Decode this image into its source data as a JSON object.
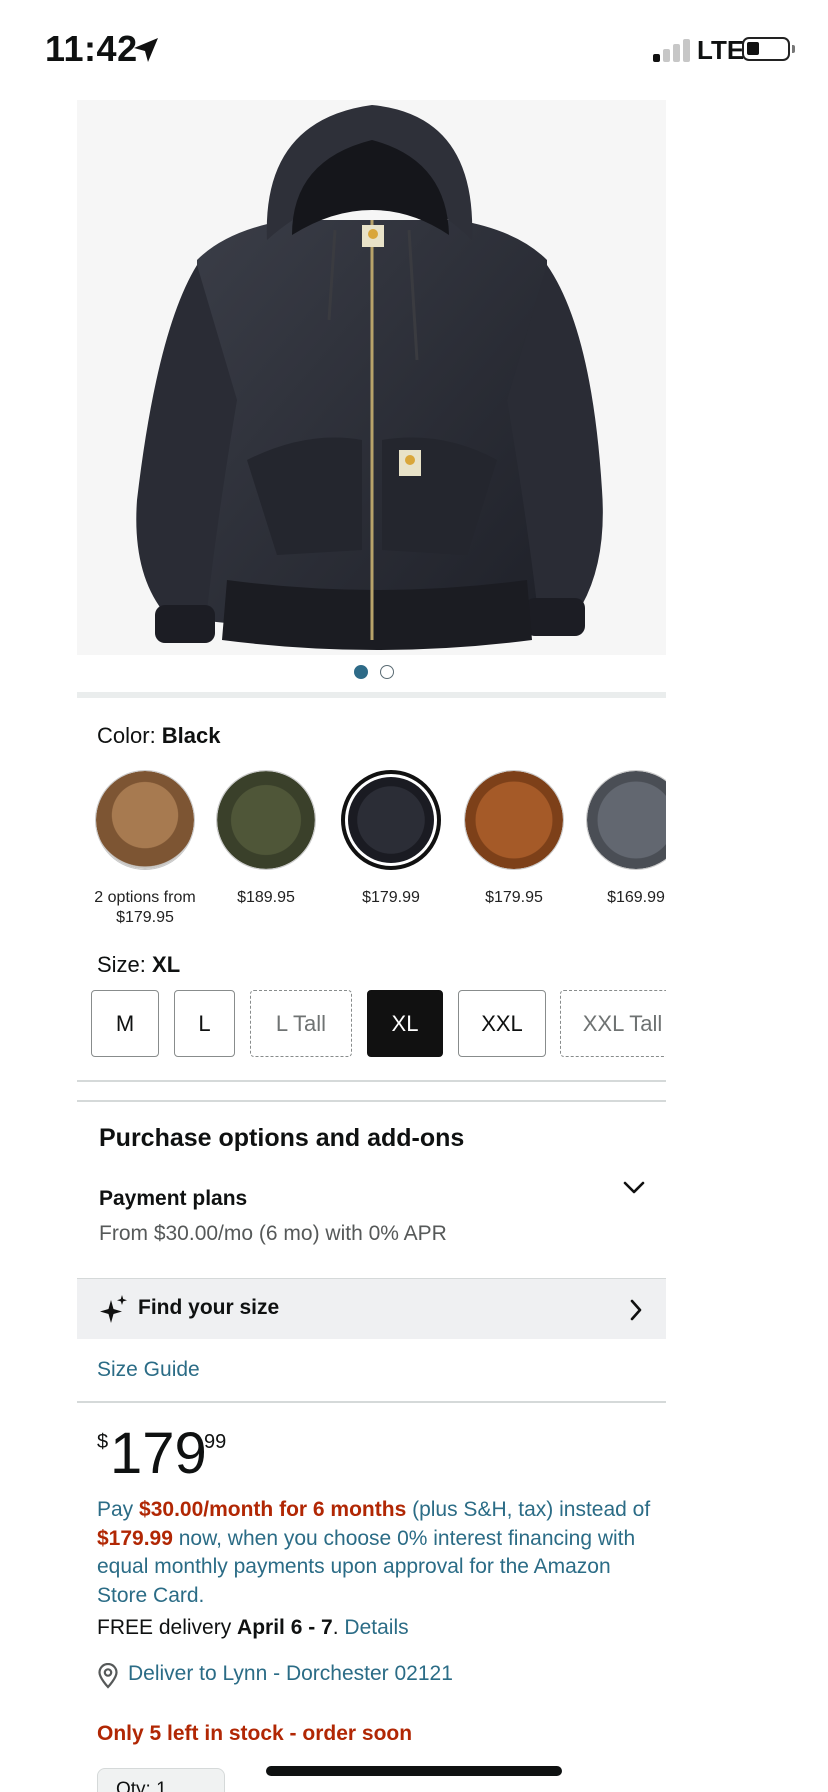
{
  "status_bar": {
    "time": "11:42",
    "network": "LTE"
  },
  "product": {
    "image_alt": "Black hooded jacket",
    "carousel": {
      "count": 2,
      "active_index": 0
    }
  },
  "color": {
    "label": "Color: ",
    "selected": "Black",
    "options": [
      {
        "line1": "2 options from",
        "line2": "$179.95",
        "color": "#9a6b44"
      },
      {
        "line1": "$189.95",
        "line2": "",
        "color": "#4c5236"
      },
      {
        "line1": "$179.99",
        "line2": "",
        "color": "#24262d",
        "selected": true
      },
      {
        "line1": "$179.95",
        "line2": "",
        "color": "#9d5324"
      },
      {
        "line1": "$169.99",
        "line2": "",
        "color": "#5b6067"
      }
    ]
  },
  "size": {
    "label": "Size: ",
    "selected": "XL",
    "options": [
      "M",
      "L",
      "L Tall",
      "XL",
      "XXL",
      "XXL Tall"
    ]
  },
  "purchase_options": {
    "title": "Purchase options and add-ons",
    "payment_plans_title": "Payment plans",
    "payment_plans_sub": "From $30.00/mo (6 mo) with 0% APR"
  },
  "find_size": {
    "label": "Find your size"
  },
  "size_guide": {
    "label": "Size Guide"
  },
  "price": {
    "symbol": "$",
    "whole": "179",
    "fraction": "99"
  },
  "financing": {
    "t1": "Pay ",
    "t2": "$30.00/month for 6 months",
    "t3": " (plus S&H, tax) instead of ",
    "t4": "$179.99",
    "t5": " now, when you choose 0% interest financing with equal monthly payments upon approval for the Amazon Store Card."
  },
  "delivery": {
    "prefix": "FREE delivery ",
    "dates": "April 6 - 7",
    "sep": ". ",
    "details_link": "Details",
    "deliver_to": "Deliver to Lynn - Dorchester 02121"
  },
  "stock": {
    "message": "Only 5 left in stock - order soon"
  },
  "quantity": {
    "label": "Qty: 1"
  },
  "colors": {
    "link": "#2b6c86",
    "price_red": "#b12704",
    "dot_active": "#2e6b88"
  }
}
